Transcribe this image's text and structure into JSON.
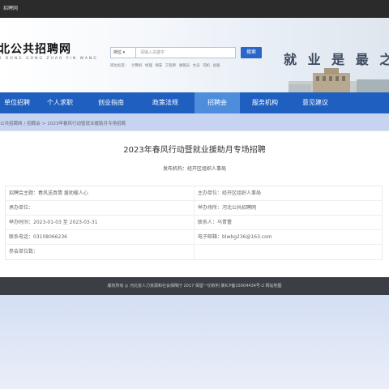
{
  "titlebar": {
    "text": "招聘网"
  },
  "header": {
    "logo": "北公共招聘网",
    "logo_pinyin": "I   DONG  GONG  ZHAO  PIN  WANG",
    "search": {
      "select": "岗位 ▾",
      "placeholder": "请输入关键字",
      "button": "搜索"
    },
    "hot_label": "岗位标签：",
    "hot_terms": [
      "计算机",
      "经理",
      "保安",
      "工程师",
      "收银员",
      "文员",
      "司机",
      "总账"
    ],
    "slogan": "就 业 是 最 之"
  },
  "nav": {
    "items": [
      {
        "label": "单位招聘",
        "active": false
      },
      {
        "label": "个人求职",
        "active": false
      },
      {
        "label": "创业指南",
        "active": false
      },
      {
        "label": "政策法规",
        "active": false
      },
      {
        "label": "招聘会",
        "active": true
      },
      {
        "label": "服务机构",
        "active": false
      },
      {
        "label": "意见建议",
        "active": false
      }
    ]
  },
  "breadcrumb": [
    "公共招聘网",
    "招聘会",
    "2023年春风行动暨就业援助月专场招聘"
  ],
  "job": {
    "title": "2023年春风行动暨就业援助月专场招聘",
    "publisher": "发布机构：经开区组织人事局"
  },
  "info": [
    [
      "招聘会主题：春风送真情 援助暖人心",
      "主办单位：经开区组织人事局"
    ],
    [
      "承办单位：",
      "举办场所：河北公共招聘网"
    ],
    [
      "举办时间：2023-01-03 至 2023-03-31",
      "联系人：马青蕾"
    ],
    [
      "联系电话：03108066236",
      "电子邮箱：blwbg236@163.com"
    ],
    [
      "参会单位数：",
      ""
    ]
  ],
  "footer": {
    "text": "版权所有 ◎ 河北省人力资源和社会保障厅 2017    保留一切权利    冀ICP备15004434号-2    网站地图"
  },
  "colors": {
    "nav": "#1f5fbf",
    "nav_active": "#4d8ddc",
    "footer": "#3b3f45",
    "search_button": "#2a66c8"
  }
}
